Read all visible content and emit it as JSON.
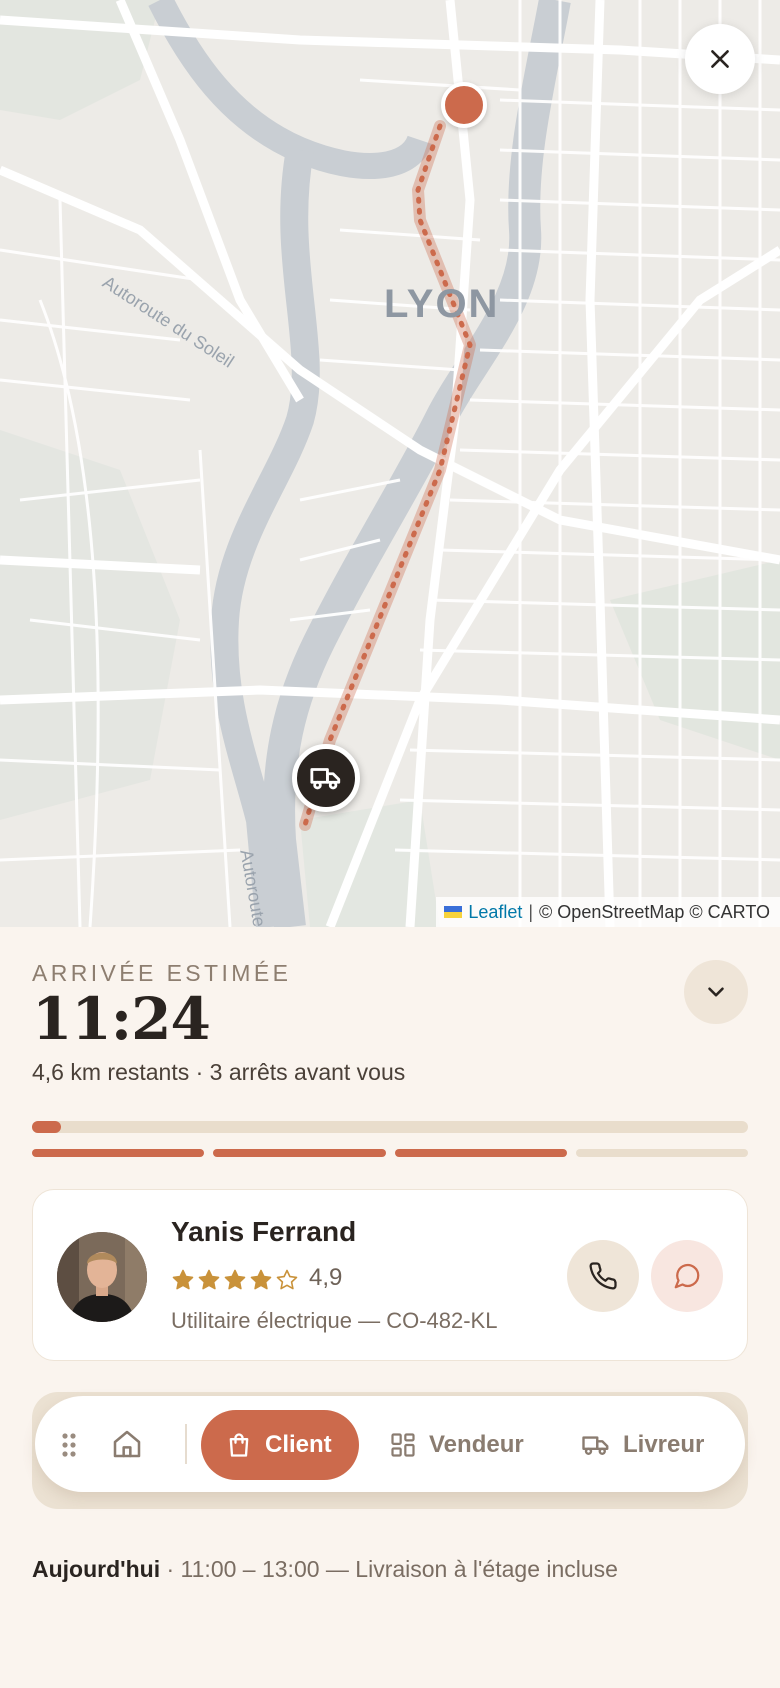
{
  "map": {
    "city_label": "LYON",
    "road_labels": [
      "Autoroute du Soleil",
      "Autoroute"
    ],
    "attribution": {
      "leaflet": "Leaflet",
      "separator": "|",
      "osm": "© OpenStreetMap © CARTO"
    },
    "route_color": "#cc6a4c",
    "icons": {
      "close": "close-icon",
      "destination": "destination-pin-icon",
      "truck": "truck-icon"
    }
  },
  "eta": {
    "caption": "ARRIVÉE ESTIMÉE",
    "time": "11:24",
    "subtitle": "4,6 km restants · 3 arrêts avant vous",
    "progress_fraction": 0.04,
    "stops_total": 4,
    "stops_done": 3
  },
  "driver": {
    "name": "Yanis Ferrand",
    "stars_full": 4,
    "stars_total": 5,
    "rating": "4,9",
    "vehicle": "Utilitaire électrique — CO-482-KL"
  },
  "nav": {
    "tabs": [
      {
        "label": "Client",
        "icon": "shopping-bag-icon",
        "active": true
      },
      {
        "label": "Vendeur",
        "icon": "grid-icon",
        "active": false
      },
      {
        "label": "Livreur",
        "icon": "truck-icon",
        "active": false
      }
    ]
  },
  "footer": {
    "day": "Aujourd'hui",
    "detail": " · 11:00 – 13:00 — Livraison à l'étage incluse"
  },
  "colors": {
    "accent": "#cc6a4c",
    "background": "#faf4ee",
    "star": "#c9923a"
  }
}
